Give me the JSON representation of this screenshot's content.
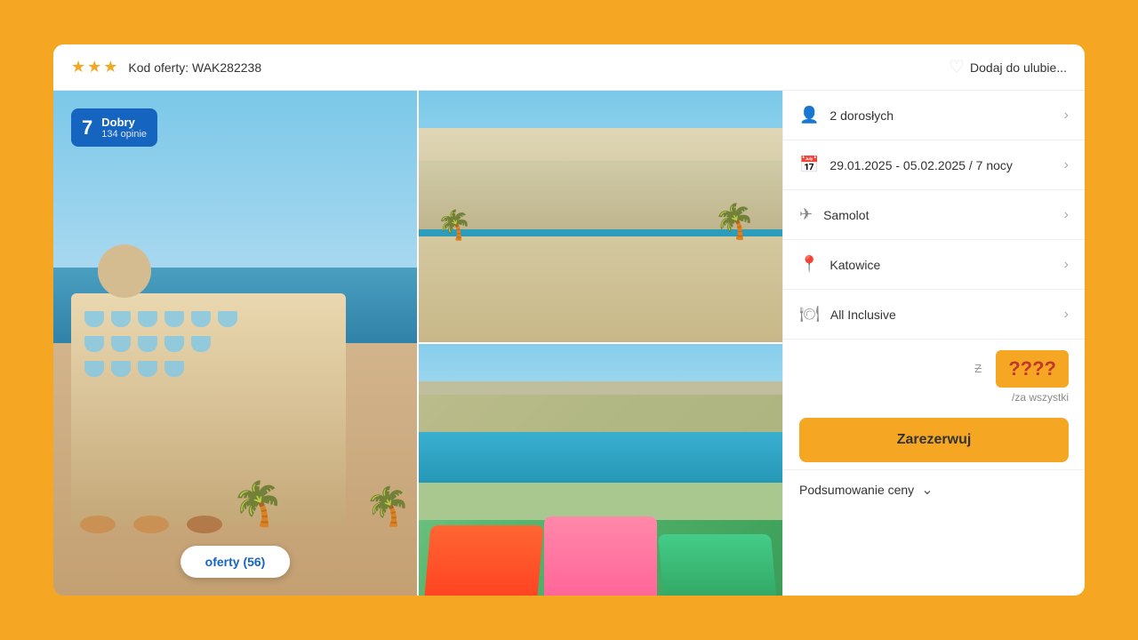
{
  "header": {
    "stars": [
      "★",
      "★",
      "★"
    ],
    "offer_code_label": "Kod oferty: WAK282238",
    "favorite_label": "Dodaj do ulubie...",
    "heart_unicode": "♡"
  },
  "rating": {
    "number": "7",
    "label": "Dobry",
    "count_label": "134 opinie"
  },
  "offers_button": {
    "label": "oferty (56)"
  },
  "booking": {
    "guests": {
      "icon": "👤",
      "value": "2 dorosłych"
    },
    "dates": {
      "icon": "📅",
      "value": "29.01.2025 - 05.02.2025 / 7 nocy"
    },
    "transport": {
      "icon": "✈",
      "value": "Samolot"
    },
    "departure": {
      "icon": "📍",
      "value": "Katowice"
    },
    "board": {
      "icon": "🍽",
      "value": "All Inclusive"
    },
    "price_badge": "????",
    "price_per": "/za wszystki",
    "book_button_label": "Zarezerwuj",
    "summary_label": "Podsumowanie ceny"
  }
}
